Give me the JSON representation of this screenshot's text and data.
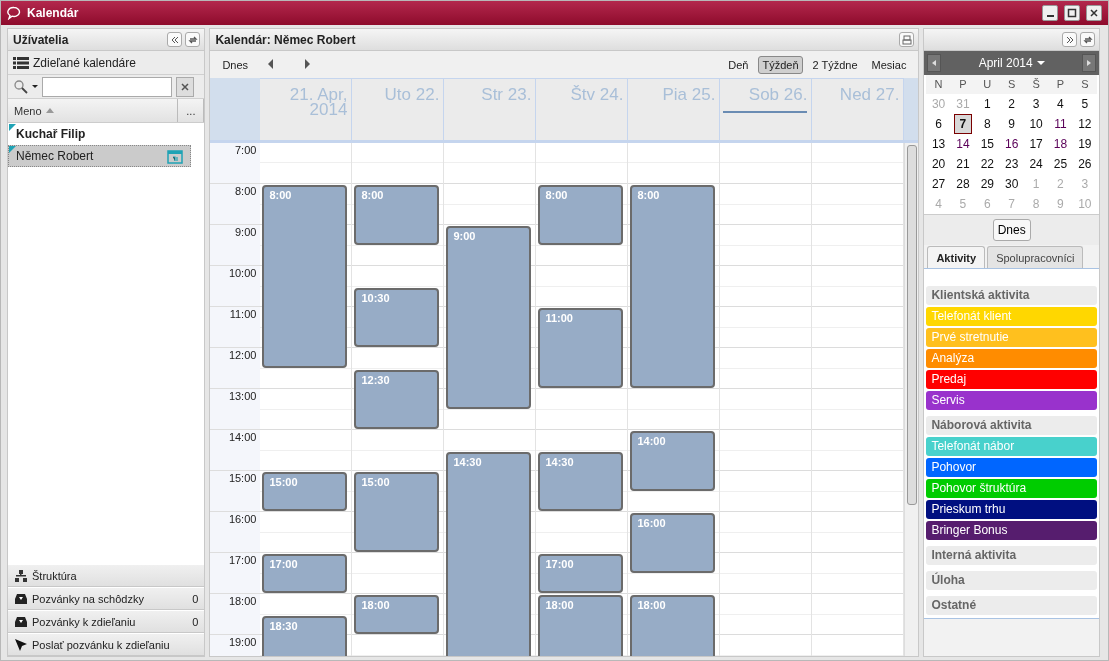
{
  "window": {
    "title": "Kalendár"
  },
  "users_panel": {
    "title": "Užívatelia",
    "shared_calendars": "Zdieľané kalendáre",
    "column": "Meno",
    "column_more": "...",
    "users": [
      {
        "name": "Kuchař Filip",
        "selected": false,
        "emphasized": true,
        "has_calendar": false
      },
      {
        "name": "Němec Robert",
        "selected": true,
        "emphasized": false,
        "has_calendar": true
      }
    ],
    "sections": [
      {
        "kind": "structure",
        "label": "Štruktúra"
      },
      {
        "kind": "inbox",
        "label": "Pozvánky na schôdzky",
        "count": "0"
      },
      {
        "kind": "inbox",
        "label": "Pozvánky k zdieľaniu",
        "count": "0"
      },
      {
        "kind": "send",
        "label": "Poslať pozvánku k zdieľaniu"
      }
    ]
  },
  "calendar": {
    "title": "Kalendár: Němec Robert",
    "today": "Dnes",
    "views": [
      {
        "label": "Deň",
        "selected": false
      },
      {
        "label": "Týždeň",
        "selected": true
      },
      {
        "label": "2 Týždne",
        "selected": false
      },
      {
        "label": "Mesiac",
        "selected": false
      }
    ],
    "hours": [
      "7:00",
      "8:00",
      "9:00",
      "10:00",
      "11:00",
      "12:00",
      "13:00",
      "14:00",
      "15:00",
      "16:00",
      "17:00",
      "18:00",
      "19:00"
    ],
    "days": [
      {
        "label": "21. Apr, 2014",
        "current": false,
        "events": [
          {
            "start": "8:00"
          },
          {
            "start": "15:00"
          },
          {
            "start": "17:00"
          },
          {
            "start": "18:30"
          }
        ]
      },
      {
        "label": "Uto 22.",
        "current": false,
        "events": [
          {
            "start": "8:00"
          },
          {
            "start": "10:30"
          },
          {
            "start": "12:30"
          },
          {
            "start": "15:00"
          },
          {
            "start": "18:00"
          }
        ]
      },
      {
        "label": "Str 23.",
        "current": false,
        "events": [
          {
            "start": "9:00"
          },
          {
            "start": "14:30"
          }
        ]
      },
      {
        "label": "Štv 24.",
        "current": false,
        "events": [
          {
            "start": "8:00"
          },
          {
            "start": "11:00"
          },
          {
            "start": "14:30"
          },
          {
            "start": "17:00"
          },
          {
            "start": "18:00"
          }
        ]
      },
      {
        "label": "Pia 25.",
        "current": false,
        "events": [
          {
            "start": "8:00"
          },
          {
            "start": "14:00"
          },
          {
            "start": "16:00"
          },
          {
            "start": "18:00"
          }
        ]
      },
      {
        "label": "Sob 26.",
        "current": true
      },
      {
        "label": "Ned 27.",
        "current": false
      }
    ]
  },
  "mini_calendar": {
    "month": "April 2014",
    "weekdays": [
      "N",
      "P",
      "U",
      "S",
      "Š",
      "P",
      "S"
    ],
    "days": [
      {
        "label": "30",
        "other_month": true,
        "selected": false,
        "marked": false
      },
      {
        "label": "31",
        "other_month": true,
        "selected": false,
        "marked": false
      },
      {
        "label": "1",
        "other_month": false,
        "selected": false,
        "marked": false
      },
      {
        "label": "2",
        "other_month": false,
        "selected": false,
        "marked": false
      },
      {
        "label": "3",
        "other_month": false,
        "selected": false,
        "marked": false
      },
      {
        "label": "4",
        "other_month": false,
        "selected": false,
        "marked": false
      },
      {
        "label": "5",
        "other_month": false,
        "selected": false,
        "marked": false
      },
      {
        "label": "6",
        "other_month": false,
        "selected": false,
        "marked": false
      },
      {
        "label": "7",
        "other_month": false,
        "selected": true,
        "marked": false
      },
      {
        "label": "8",
        "other_month": false,
        "selected": false,
        "marked": false
      },
      {
        "label": "9",
        "other_month": false,
        "selected": false,
        "marked": false
      },
      {
        "label": "10",
        "other_month": false,
        "selected": false,
        "marked": false
      },
      {
        "label": "11",
        "other_month": false,
        "selected": false,
        "marked": true
      },
      {
        "label": "12",
        "other_month": false,
        "selected": false,
        "marked": false
      },
      {
        "label": "13",
        "other_month": false,
        "selected": false,
        "marked": false
      },
      {
        "label": "14",
        "other_month": false,
        "selected": false,
        "marked": true
      },
      {
        "label": "15",
        "other_month": false,
        "selected": false,
        "marked": false
      },
      {
        "label": "16",
        "other_month": false,
        "selected": false,
        "marked": true
      },
      {
        "label": "17",
        "other_month": false,
        "selected": false,
        "marked": false
      },
      {
        "label": "18",
        "other_month": false,
        "selected": false,
        "marked": true
      },
      {
        "label": "19",
        "other_month": false,
        "selected": false,
        "marked": false
      },
      {
        "label": "20",
        "other_month": false,
        "selected": false,
        "marked": false
      },
      {
        "label": "21",
        "other_month": false,
        "selected": false,
        "marked": false
      },
      {
        "label": "22",
        "other_month": false,
        "selected": false,
        "marked": false
      },
      {
        "label": "23",
        "other_month": false,
        "selected": false,
        "marked": false
      },
      {
        "label": "24",
        "other_month": false,
        "selected": false,
        "marked": false
      },
      {
        "label": "25",
        "other_month": false,
        "selected": false,
        "marked": false
      },
      {
        "label": "26",
        "other_month": false,
        "selected": false,
        "marked": false
      },
      {
        "label": "27",
        "other_month": false,
        "selected": false,
        "marked": false
      },
      {
        "label": "28",
        "other_month": false,
        "selected": false,
        "marked": false
      },
      {
        "label": "29",
        "other_month": false,
        "selected": false,
        "marked": false
      },
      {
        "label": "30",
        "other_month": false,
        "selected": false,
        "marked": false
      },
      {
        "label": "1",
        "other_month": true,
        "selected": false,
        "marked": false
      },
      {
        "label": "2",
        "other_month": true,
        "selected": false,
        "marked": false
      },
      {
        "label": "3",
        "other_month": true,
        "selected": false,
        "marked": false
      },
      {
        "label": "4",
        "other_month": true,
        "selected": false,
        "marked": false
      },
      {
        "label": "5",
        "other_month": true,
        "selected": false,
        "marked": false
      },
      {
        "label": "6",
        "other_month": true,
        "selected": false,
        "marked": false
      },
      {
        "label": "7",
        "other_month": true,
        "selected": false,
        "marked": false
      },
      {
        "label": "8",
        "other_month": true,
        "selected": false,
        "marked": false
      },
      {
        "label": "9",
        "other_month": true,
        "selected": false,
        "marked": false
      },
      {
        "label": "10",
        "other_month": true,
        "selected": false,
        "marked": false
      }
    ],
    "today": "Dnes"
  },
  "side_tabs": [
    {
      "label": "Aktivity",
      "selected": true
    },
    {
      "label": "Spolupracovníci",
      "selected": false
    }
  ],
  "activity_groups": [
    {
      "title": "Klientská aktivita",
      "items": [
        {
          "label": "Telefonát klient",
          "color": "#ffd700"
        },
        {
          "label": "Prvé stretnutie",
          "color": "#ffc01e"
        },
        {
          "label": "Analýza",
          "color": "#ff8c00"
        },
        {
          "label": "Predaj",
          "color": "#ff0000"
        },
        {
          "label": "Servis",
          "color": "#9932cc"
        }
      ]
    },
    {
      "title": "Náborová aktivita",
      "items": [
        {
          "label": "Telefonát nábor",
          "color": "#48d1cc"
        },
        {
          "label": "Pohovor",
          "color": "#0066ff"
        },
        {
          "label": "Pohovor štruktúra",
          "color": "#00cc00"
        },
        {
          "label": "Prieskum trhu",
          "color": "#000f80"
        },
        {
          "label": "Bringer Bonus",
          "color": "#561d6e"
        }
      ]
    },
    {
      "title": "Interná aktivita"
    },
    {
      "title": "Úloha"
    },
    {
      "title": "Ostatné"
    }
  ]
}
